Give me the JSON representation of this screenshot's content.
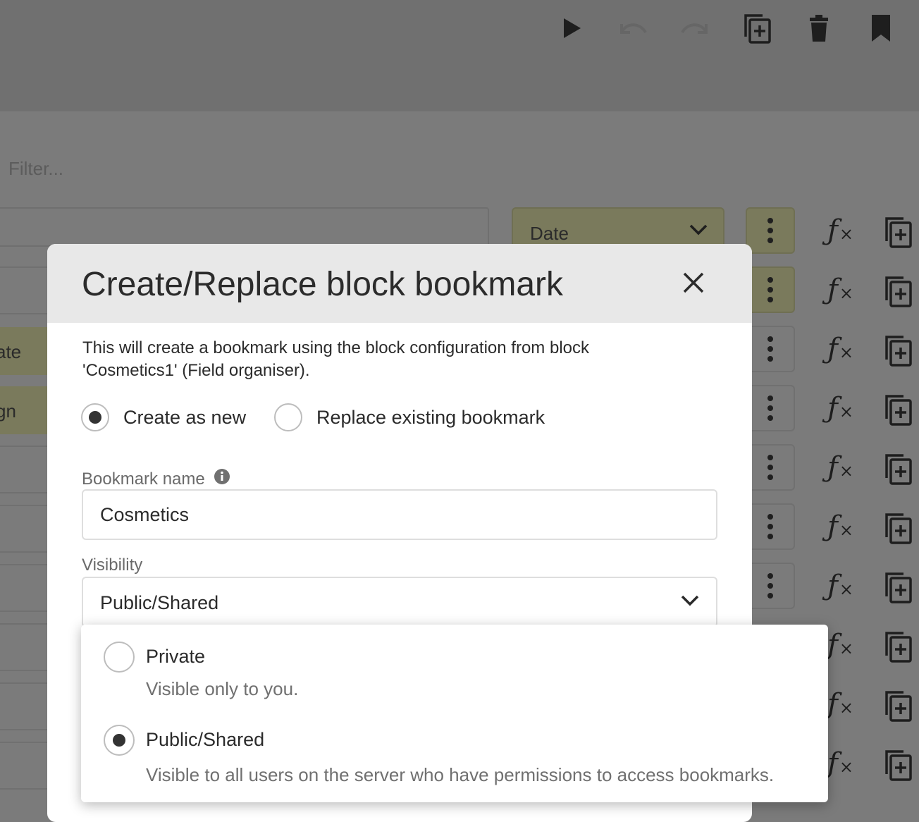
{
  "toolbar": {
    "icons": [
      "play-icon",
      "undo-icon",
      "redo-icon",
      "duplicate-icon",
      "trash-icon",
      "bookmark-icon"
    ]
  },
  "background": {
    "filter_placeholder": "Filter...",
    "row_labels": [
      "ate",
      "gn"
    ],
    "date_select_label": "Date",
    "function_icon_label": "ƒ",
    "function_icon_suffix": "×"
  },
  "modal": {
    "title": "Create/Replace block bookmark",
    "description": "This will create a bookmark using the block configuration from block 'Cosmetics1' (Field organiser).",
    "mode_options": [
      {
        "label": "Create as new",
        "selected": true
      },
      {
        "label": "Replace existing bookmark",
        "selected": false
      }
    ],
    "bookmark_name_label": "Bookmark name",
    "bookmark_name_value": "Cosmetics",
    "visibility_label": "Visibility",
    "visibility_value": "Public/Shared"
  },
  "visibility_dropdown": {
    "options": [
      {
        "title": "Private",
        "description": "Visible only to you.",
        "selected": false
      },
      {
        "title": "Public/Shared",
        "description": "Visible to all users on the server who have permissions to access bookmarks.",
        "selected": true
      }
    ]
  },
  "colors": {
    "overlay": "#7b7b7b",
    "header": "#e8e8e8",
    "olive": "#7a7a5c",
    "text": "#2b2b2b"
  }
}
